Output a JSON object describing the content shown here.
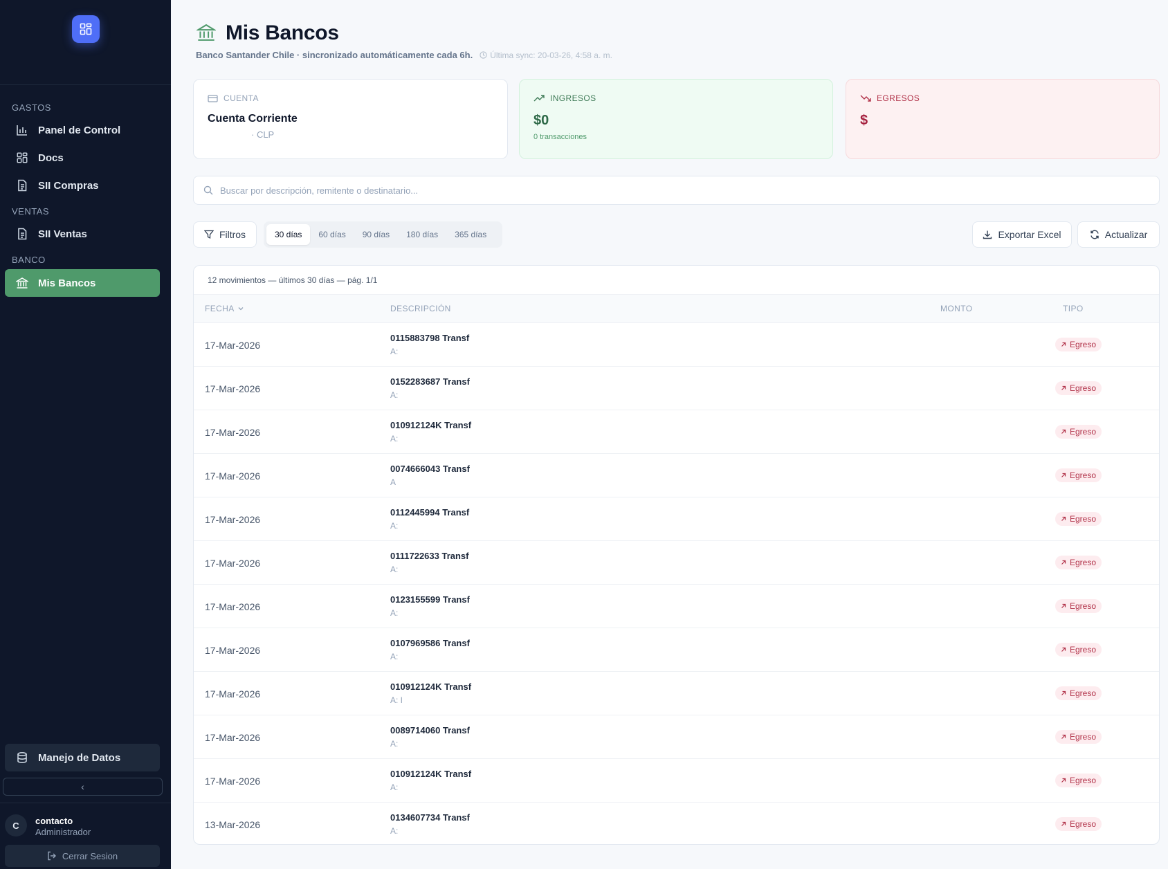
{
  "sidebar": {
    "sections": {
      "gastos": "GASTOS",
      "ventas": "VENTAS",
      "banco": "BANCO"
    },
    "items": [
      {
        "label": "Panel de Control",
        "icon": "bar-chart-icon"
      },
      {
        "label": "Docs",
        "icon": "grid-icon"
      },
      {
        "label": "SII Compras",
        "icon": "file-text-icon"
      },
      {
        "label": "SII Ventas",
        "icon": "file-text-icon"
      },
      {
        "label": "Mis Bancos",
        "icon": "bank-icon",
        "active": true
      }
    ],
    "data_button": "Manejo de Datos",
    "collapse_icon": "‹",
    "user": {
      "initial": "C",
      "name": "contacto",
      "role": "Administrador"
    },
    "logout": "Cerrar Sesion"
  },
  "header": {
    "title": "Mis Bancos",
    "subtitle": "Banco Santander Chile · sincronizado automáticamente cada 6h.",
    "last_sync": "Última sync: 20-03-26, 4:58 a. m."
  },
  "cards": {
    "account": {
      "label": "CUENTA",
      "name": "Cuenta Corriente",
      "currency": "· CLP"
    },
    "income": {
      "label": "INGRESOS",
      "amount": "$0",
      "sub": "0 transacciones"
    },
    "expense": {
      "label": "EGRESOS",
      "amount": "$"
    }
  },
  "search": {
    "placeholder": "Buscar por descripción, remitente o destinatario...",
    "value": ""
  },
  "toolbar": {
    "filters": "Filtros",
    "ranges": [
      "30 días",
      "60 días",
      "90 días",
      "180 días",
      "365 días"
    ],
    "active_range": "30 días",
    "export": "Exportar Excel",
    "refresh": "Actualizar"
  },
  "table": {
    "summary": "12 movimientos — últimos 30 días — pág. 1/1",
    "headers": {
      "fecha": "FECHA",
      "descripcion": "DESCRIPCIÓN",
      "monto": "MONTO",
      "tipo": "TIPO"
    },
    "rows": [
      {
        "date": "17-Mar-2026",
        "desc": "0115883798 Transf",
        "sub": "A:",
        "type": "Egreso"
      },
      {
        "date": "17-Mar-2026",
        "desc": "0152283687 Transf",
        "sub": "A:",
        "type": "Egreso"
      },
      {
        "date": "17-Mar-2026",
        "desc": "010912124K Transf",
        "sub": "A:",
        "type": "Egreso"
      },
      {
        "date": "17-Mar-2026",
        "desc": "0074666043 Transf",
        "sub": "A",
        "type": "Egreso"
      },
      {
        "date": "17-Mar-2026",
        "desc": "0112445994 Transf",
        "sub": "A:",
        "type": "Egreso"
      },
      {
        "date": "17-Mar-2026",
        "desc": "0111722633 Transf",
        "sub": "A:",
        "type": "Egreso"
      },
      {
        "date": "17-Mar-2026",
        "desc": "0123155599 Transf",
        "sub": "A:",
        "type": "Egreso"
      },
      {
        "date": "17-Mar-2026",
        "desc": "0107969586 Transf",
        "sub": "A:",
        "type": "Egreso"
      },
      {
        "date": "17-Mar-2026",
        "desc": "010912124K Transf",
        "sub": "A: I",
        "type": "Egreso"
      },
      {
        "date": "17-Mar-2026",
        "desc": "0089714060 Transf",
        "sub": "A:",
        "type": "Egreso"
      },
      {
        "date": "17-Mar-2026",
        "desc": "010912124K Transf",
        "sub": "A:",
        "type": "Egreso"
      },
      {
        "date": "13-Mar-2026",
        "desc": "0134607734 Transf",
        "sub": "A:",
        "type": "Egreso"
      }
    ]
  },
  "colors": {
    "sidebar_bg": "#0f172a",
    "accent_green": "#4f9a6b",
    "logo_blue": "#4f6ef7",
    "expense_red": "#b13249"
  }
}
